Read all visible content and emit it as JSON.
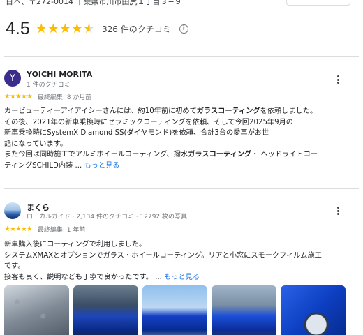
{
  "place": {
    "address": "日本、〒272-0014 千葉県市川市田尻１丁目３−９",
    "rating": "4.5",
    "review_count": "326 件のクチコミ"
  },
  "reviews": [
    {
      "initial": "Y",
      "name": "YOICHI MORITA",
      "sub": "1 件のクチコミ",
      "rating": 5,
      "stars": "★★★★★",
      "meta": "最終編集: 8 か月前",
      "lines": [
        [
          "カービューティーアイアイシーさんには、約10年前に初めて",
          "ガラスコーティング",
          "を依頼しました。"
        ],
        [
          "その後、2021年の新車乗換時にセラミックコーティングを依頼、そして今回2025年9月の"
        ],
        [
          "新車乗換時にSystemX Diamond SS(ダイヤモンド)を依頼、合計3台の愛車がお世"
        ],
        [
          "話になっています。"
        ],
        [
          "また今回は同時施工でアルミホイールコーティング、撥水",
          "ガラスコーティング",
          "・ ヘッドライトコー"
        ],
        [
          "ティングSCHILD内装 ... "
        ]
      ],
      "more_label": "もっと見る"
    },
    {
      "name": "まくら",
      "sub": "ローカルガイド · 2,134 件のクチコミ · 12792 枚の写真",
      "rating": 5,
      "stars": "★★★★★",
      "meta": "最終編集: 1 年前",
      "lines": [
        [
          "新車購入後にコーティングで利用しました。"
        ],
        [
          "システムXMAXとオプションでガラス・ホイールコーティング。リアと小窓にスモークフィルム施工"
        ],
        [
          "です。"
        ],
        [
          "接客も良く、説明なども丁寧で良かったです。 ... "
        ]
      ],
      "more_label": "もっと見る"
    }
  ]
}
